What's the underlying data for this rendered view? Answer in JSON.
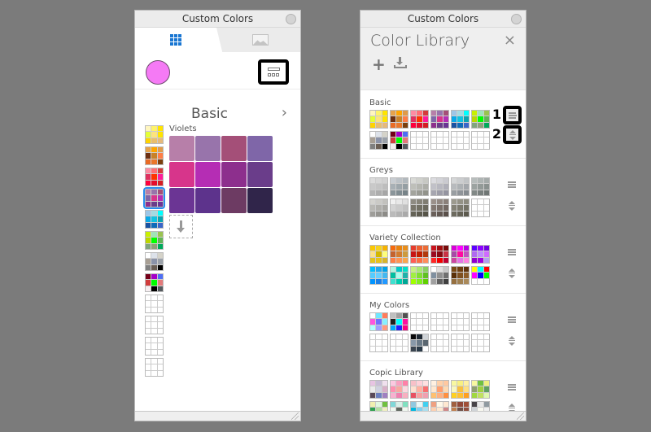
{
  "left_window": {
    "title": "Custom Colors",
    "tabs": [
      {
        "icon": "grid-icon",
        "active": true
      },
      {
        "icon": "image-icon",
        "active": false
      }
    ],
    "current_color": "#f57af5",
    "set_name": "Basic",
    "next_label": "›",
    "group_label": "Violets",
    "violets": [
      "#b77fa9",
      "#9874ab",
      "#a44f78",
      "#7f66a8",
      "#d7358b",
      "#b52db4",
      "#8d2f8d",
      "#6a3d8a",
      "#6b3594",
      "#5d338c",
      "#6d3b63",
      "#30254a"
    ],
    "sidebar_sets": [
      [
        "#fff6bf",
        "#fff36a",
        "#ffe400",
        "#e4ff37",
        "#fde47d",
        "#ffe400",
        "#ffd300",
        "#e9be6e",
        "#e6b97b"
      ],
      [
        "#e6a24c",
        "#ffa400",
        "#e09a4a",
        "#6d2f10",
        "#c88129",
        "#fe7d46",
        "#e96b24",
        "#e9772a",
        "#7b3f0e"
      ],
      [
        "#fe8aa2",
        "#ff6e76",
        "#d43b3b",
        "#df3060",
        "#ff3300",
        "#ff1a9a",
        "#ff003d",
        "#e40c2c",
        "#d41e24"
      ],
      [
        "#b77fa9",
        "#9874ab",
        "#a44f78",
        "#7f66a8",
        "#d7358b",
        "#b52db4",
        "#8d2f8d",
        "#6a3d8a",
        "#6b3594"
      ],
      [
        "#9dc6e7",
        "#a3dbe3",
        "#00ffff",
        "#0aa9e8",
        "#12c3e0",
        "#0aa4b1",
        "#1952a2",
        "#0f6bb9",
        "#3a66c9"
      ],
      [
        "#c8f000",
        "#a0e3b8",
        "#9ac350",
        "#bcd600",
        "#00ff00",
        "#61b356",
        "#81a57e",
        "#8fa07b",
        "#00a95b"
      ],
      [
        "#ffffff",
        "#dde2ea",
        "#d5d3c9",
        "#a89f94",
        "#8b93a9",
        "#9aa0a8",
        "#808080",
        "#6b5f55",
        "#000000"
      ],
      [
        "#750019",
        "#a500c8",
        "#4d6ef4",
        "#d13c3c",
        "#00ff00",
        "#e37a7a",
        "#f6eef1",
        "#000000",
        "#555a5e"
      ],
      [],
      [],
      [],
      []
    ],
    "selected_set_index": 3
  },
  "right_window": {
    "title": "Custom Colors",
    "header_title": "Color Library",
    "close_label": "×",
    "add_label": "+",
    "callouts": [
      "1",
      "2"
    ],
    "sections": [
      {
        "name": "Basic",
        "sets": [
          [
            "#fff6bf",
            "#fff36a",
            "#ffe400",
            "#e4ff37",
            "#fde47d",
            "#ffe400",
            "#ffd300",
            "#e9be6e",
            "#e6b97b"
          ],
          [
            "#e6a24c",
            "#ffa400",
            "#e09a4a",
            "#6d2f10",
            "#c88129",
            "#fe7d46",
            "#e96b24",
            "#e9772a",
            "#7b3f0e"
          ],
          [
            "#fe8aa2",
            "#ff6e76",
            "#d43b3b",
            "#df3060",
            "#ff3300",
            "#ff1a9a",
            "#ff003d",
            "#e40c2c",
            "#d41e24"
          ],
          [
            "#b77fa9",
            "#9874ab",
            "#a44f78",
            "#7f66a8",
            "#d7358b",
            "#b52db4",
            "#8d2f8d",
            "#6a3d8a",
            "#6b3594"
          ],
          [
            "#9dc6e7",
            "#a3dbe3",
            "#00ffff",
            "#0aa9e8",
            "#12c3e0",
            "#0aa4b1",
            "#1952a2",
            "#0f6bb9",
            "#3a66c9"
          ],
          [
            "#c8f000",
            "#a0e3b8",
            "#9ac350",
            "#bcd600",
            "#00ff00",
            "#61b356",
            "#81a57e",
            "#8fa07b",
            "#00a95b"
          ],
          [
            "#ffffff",
            "#dde2ea",
            "#d5d3c9",
            "#a89f94",
            "#8b93a9",
            "#9aa0a8",
            "#808080",
            "#6b5f55",
            "#000000"
          ],
          [
            "#750019",
            "#a500c8",
            "#4d6ef4",
            "#d13c3c",
            "#00ff00",
            "#e37a7a",
            "#f6eef1",
            "#000000",
            "#555a5e"
          ],
          [],
          [],
          [],
          []
        ]
      },
      {
        "name": "Greys",
        "sets": [
          [
            "#dcdcdc",
            "#d6d6d6",
            "#d2d2d2",
            "#c9c9c9",
            "#c4c4c4",
            "#bdbdbd",
            "#b5b5b5",
            "#adadad",
            "#a6a6a6"
          ],
          [
            "#c8cdd2",
            "#bcc2c7",
            "#b2b9be",
            "#a8b0b5",
            "#9ea7ac",
            "#949ea3",
            "#8a959a",
            "#808c91",
            "#778388"
          ],
          [
            "#d9dad6",
            "#d0d1cc",
            "#c7c8c3",
            "#bebfb9",
            "#b5b6b0",
            "#acada7",
            "#a3a49d",
            "#9a9b94",
            "#92938b"
          ],
          [
            "#dcdce0",
            "#d3d3d8",
            "#cacad0",
            "#c1c1c8",
            "#b8b8c0",
            "#afafb8",
            "#a6a6b0",
            "#9d9da8",
            "#9494a0"
          ],
          [
            "#d5d7d8",
            "#cbcdcf",
            "#c1c4c6",
            "#b7babd",
            "#adb1b4",
            "#a3a7ab",
            "#999ea2",
            "#8f9499",
            "#858b90"
          ],
          [
            "#b7bdbc",
            "#aeb4b3",
            "#a5abaa",
            "#9ca3a1",
            "#939a98",
            "#8a918f",
            "#818886",
            "#787f7d",
            "#6f7674"
          ],
          [
            "#d4d3cf",
            "#cbcac6",
            "#c2c1bd",
            "#b9b8b4",
            "#b0afab",
            "#a7a6a2",
            "#9e9d99",
            "#959490",
            "#8c8b87"
          ],
          [
            "#f0f0f0",
            "#e8e8e8",
            "#e0e0e0",
            "#d3d3d3",
            "#cacaca",
            "#c1c1c1",
            "#bababa",
            "#b2b2b2",
            "#aaaaaa"
          ],
          [
            "#8e8b82",
            "#878479",
            "#807d72",
            "#79766b",
            "#727064",
            "#6b695d",
            "#646256",
            "#5d5b4f",
            "#565448"
          ],
          [
            "#9a908a",
            "#928882",
            "#8a807a",
            "#827872",
            "#7a706a",
            "#726862",
            "#6a605a",
            "#625852",
            "#5a504a"
          ],
          [
            "#9c9a8e",
            "#949286",
            "#8c8a7e",
            "#848276",
            "#7c7a6e",
            "#747266",
            "#6c6a5e",
            "#646256",
            "#5c5a4e"
          ],
          []
        ]
      },
      {
        "name": "Variety Collection",
        "sets": [
          [
            "#fcc800",
            "#f7d21c",
            "#f6b300",
            "#fce38a",
            "#d3b700",
            "#fefe7a",
            "#e3c31d",
            "#e8c21a",
            "#d7b42c"
          ],
          [
            "#f66b0e",
            "#e8820e",
            "#e98e1b",
            "#c4622d",
            "#d27b2e",
            "#cd9a3d",
            "#fe7f47",
            "#fe9554",
            "#f9a74e"
          ],
          [
            "#e63d2d",
            "#ee5e2f",
            "#ec6c35",
            "#c81414",
            "#c12000",
            "#b1390c",
            "#ff5d55",
            "#fb6f44",
            "#ff8c5b"
          ],
          [
            "#c9141e",
            "#a20c0e",
            "#7a0a0a",
            "#9b0a20",
            "#880a12",
            "#c93345",
            "#ff2626",
            "#f20000",
            "#c00030"
          ],
          [
            "#d800d8",
            "#ff00ff",
            "#b800e4",
            "#a64ba6",
            "#ff0aa0",
            "#c052c0",
            "#cc46a0",
            "#e573e5",
            "#ff80e0"
          ],
          [
            "#5c00ff",
            "#8c00ff",
            "#7000e0",
            "#b06af0",
            "#c08cff",
            "#d06aff",
            "#9000d0",
            "#a000e0",
            "#b0a0f0"
          ],
          [
            "#00bfff",
            "#1ea8f0",
            "#00a3e8",
            "#55ccff",
            "#68d0ff",
            "#44b8f0",
            "#0094ff",
            "#1a80e8",
            "#2299ff"
          ],
          [
            "#b0f5e0",
            "#00c8c8",
            "#00e0c8",
            "#00bfa0",
            "#aaffee",
            "#20b2aa",
            "#40e0d0",
            "#00cdb0",
            "#00a896"
          ],
          [
            "#c8f080",
            "#a8e870",
            "#88d060",
            "#a0f040",
            "#80e030",
            "#60c020",
            "#a0ff00",
            "#80f020",
            "#60d000"
          ],
          [
            "#ffffff",
            "#e0e0e0",
            "#c8c8c8",
            "#8090a0",
            "#909090",
            "#707070",
            "#a0a0a0",
            "#606060",
            "#404040"
          ],
          [
            "#7a4a14",
            "#6e3e0e",
            "#5e320a",
            "#5a3008",
            "#7e5020",
            "#8a5c2a",
            "#967040",
            "#a08050",
            "#aa8a5a"
          ],
          [
            "#ffff00",
            "#00ffff",
            "#ff0000",
            "#ff00ff",
            "#0000ff",
            "#00ff00",
            "#ffffff",
            "#ffffff",
            "#ffffff"
          ]
        ]
      },
      {
        "name": "My Colors",
        "sets": [
          [
            "#ffffff",
            "#6fe8ff",
            "#ff7b5a",
            "#ff55dd",
            "#6f70ff",
            "#88f0ff",
            "#b0ffff",
            "#a0a0ff",
            "#ff9a80"
          ],
          [
            "#c0c0c0",
            "#a0a0a0",
            "#505050",
            "#202020",
            "#00ffff",
            "#ff10a0",
            "#00aaff",
            "#2020ff",
            "#ff0080"
          ],
          [],
          [],
          [],
          [],
          [],
          [],
          [
            "#0a0a0a",
            "#1e2833",
            "#d0d4d8",
            "#8898a8",
            "#6a7a88",
            "#5a6670",
            "#3a4550",
            "#2a3a48",
            "#ffffff"
          ],
          [],
          [],
          []
        ]
      },
      {
        "name": "Copic Library",
        "sets": [
          [
            "#e7c4e2",
            "#c8bdd6",
            "#f0e0ee",
            "#ececec",
            "#cfd1e0",
            "#d8b0c8",
            "#5a4a58",
            "#6c80c0",
            "#a080c0"
          ],
          [
            "#fcc8e0",
            "#f9a0c0",
            "#ff80a8",
            "#ff90b0",
            "#f8a8a0",
            "#fcd8e0",
            "#f9b0d0",
            "#f080b0",
            "#f8b0c0"
          ],
          [
            "#f8c0c8",
            "#ffd0d8",
            "#ffe0e0",
            "#ffe0d0",
            "#ffb0a0",
            "#f87070",
            "#e85060",
            "#f8a0a0",
            "#f0a0b0"
          ],
          [
            "#fff0e0",
            "#ffd0a8",
            "#ffc8a0",
            "#ffe8d0",
            "#ffa070",
            "#ffd8b0",
            "#ffc070",
            "#ffb080",
            "#ff9040"
          ],
          [
            "#f8f8a0",
            "#f8f080",
            "#fff0a0",
            "#f8f8c0",
            "#f8c040",
            "#ffe080",
            "#ffd020",
            "#ffc030",
            "#ffa020"
          ],
          [
            "#f8f8a0",
            "#70c040",
            "#f0f080",
            "#90a070",
            "#a0d040",
            "#60a060",
            "#a0d840",
            "#c0e060",
            "#e0f8b0"
          ],
          [
            "#f0f0b0",
            "#e0f8e0",
            "#70c040",
            "#30a050",
            "#b0e0a0",
            "#f0f0c0",
            "#98b080",
            "#a8c080",
            "#e8f8e0"
          ],
          [
            "#80d8d8",
            "#d8f0e8",
            "#80e0c0",
            "#f0f8f0",
            "#606860",
            "#f0f8f0",
            "#406868",
            "#408880",
            "#98a080"
          ],
          [
            "#90c8e0",
            "#e8f8f8",
            "#40d0f0",
            "#00b8e0",
            "#80d0f0",
            "#a8e0f0",
            "#60a0c8",
            "#80d8f0",
            "#e0f0f0"
          ],
          [
            "#f0a080",
            "#fff8e8",
            "#ffe8d0",
            "#ffd0b0",
            "#ffe8d0",
            "#d08888",
            "#c08060",
            "#ffc0a0",
            "#ffe8c8"
          ],
          [
            "#a06040",
            "#904838",
            "#a05038",
            "#c08050",
            "#705048",
            "#905040",
            "#b05040",
            "#905050",
            "#a06050"
          ],
          [
            "#484448",
            "#e8e8e8",
            "#909aa0",
            "#d0d4d8",
            "#f8f8f0",
            "#f0f0f0",
            "#c8ccd0",
            "#000000",
            "#f8f8f0"
          ]
        ]
      }
    ]
  }
}
